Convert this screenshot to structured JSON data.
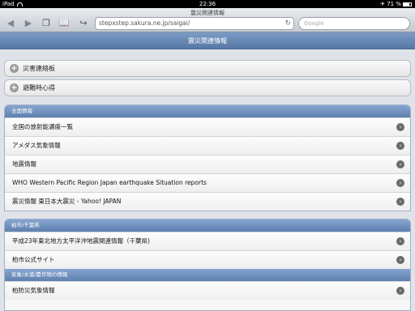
{
  "statusbar": {
    "device": "iPad",
    "time": "22:36",
    "battery": "71 %"
  },
  "browser": {
    "page_title": "震災関連情報",
    "url": "stepxstep.sakura.ne.jp/saigai/",
    "search_placeholder": "Google"
  },
  "header": {
    "title": "震災関連情報"
  },
  "collapsibles": [
    {
      "label": "災害連絡板"
    },
    {
      "label": "避難時心得"
    }
  ],
  "groups": [
    {
      "title": "全国情報",
      "items": [
        "全国の放射能濃度一覧",
        "アメダス気象情報",
        "地震情報",
        "WHO Western Pacific Region Japan earthquake Situation reports",
        "震災情報 東日本大震災 - Yahoo! JAPAN"
      ]
    },
    {
      "title": "柏市/千葉県",
      "items": [
        "平成23年東北地方太平洋沖地震関連情報（千葉県)",
        "柏市公式サイト"
      ]
    },
    {
      "title": "気象/水道/農作物の情報",
      "items": [
        "柏防災気象情報"
      ]
    }
  ]
}
